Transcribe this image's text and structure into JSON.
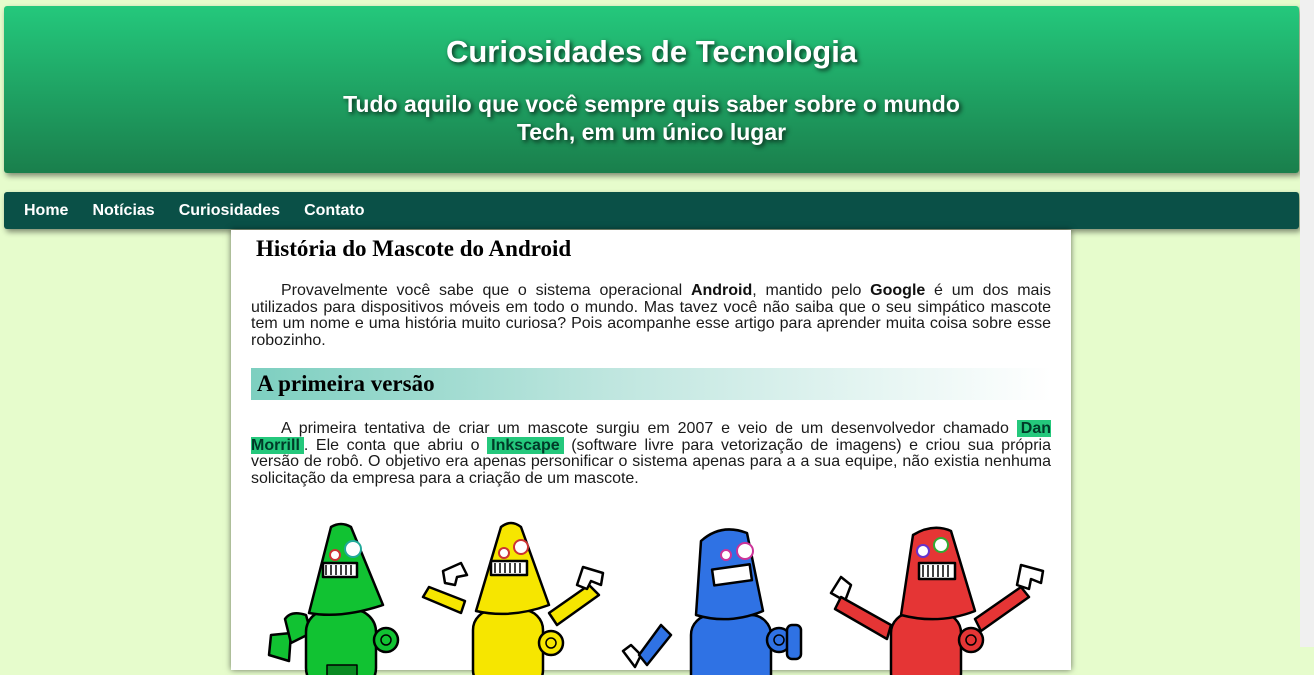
{
  "header": {
    "title": "Curiosidades de Tecnologia",
    "subtitle": "Tudo aquilo que você sempre quis saber sobre o mundo Tech, em um único lugar"
  },
  "nav": {
    "items": [
      {
        "label": "Home"
      },
      {
        "label": "Notícias"
      },
      {
        "label": "Curiosidades"
      },
      {
        "label": "Contato"
      }
    ]
  },
  "article": {
    "title": "História do Mascote do Android",
    "intro": {
      "t1": "Provavelmente você sabe que o sistema operacional ",
      "b1": "Android",
      "t2": ", mantido pelo ",
      "b2": "Google",
      "t3": " é um dos mais utilizados para dispositivos móveis em todo o mundo. Mas tavez você não saiba que o seu simpático mascote tem um nome e uma história muito curiosa? Pois acompanhe esse artigo para aprender muita coisa sobre esse robozinho."
    },
    "section1": {
      "heading": "A primeira versão",
      "t1": "A primeira tentativa de criar um mascote surgiu em 2007 e veio de um desenvolvedor chamado",
      "hl1": "Dan Morrill",
      "t2": ". Ele conta que abriu o",
      "hl2": "Inkscape",
      "t3": "(software livre para vetorização de imagens) e criou sua própria versão de robô. O objetivo era apenas personificar o sistema apenas para a a sua equipe, não existia nenhuma solicitação da empresa para a criação de um mascote."
    }
  },
  "colors": {
    "page_bg": "#e6fccc",
    "header_top": "#24c87c",
    "header_bottom": "#1a7f4c",
    "menu_bg": "#0a5047",
    "highlight": "#24c87c"
  },
  "image": {
    "robots": [
      "green",
      "yellow",
      "blue",
      "red"
    ]
  }
}
